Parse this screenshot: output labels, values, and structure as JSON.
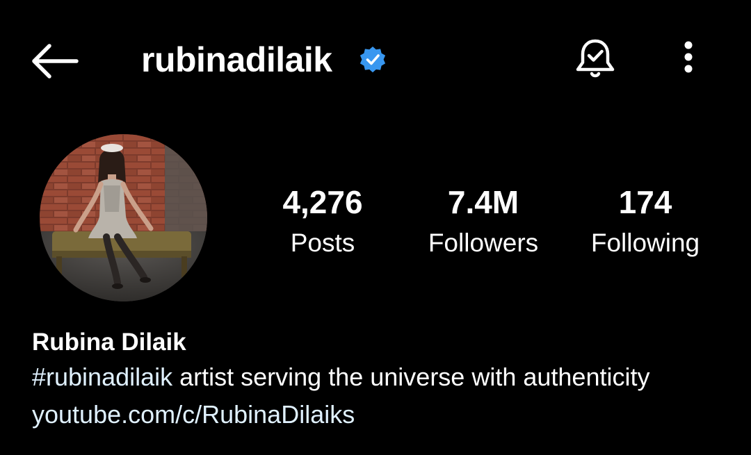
{
  "header": {
    "username": "rubinadilaik",
    "verified_color": "#3897f0",
    "back_icon": "arrow-left-icon",
    "bell_icon": "bell-check-icon",
    "more_icon": "more-vertical-icon"
  },
  "profile": {
    "avatar": "profile-photo",
    "stats": {
      "posts": {
        "value": "4,276",
        "label": "Posts"
      },
      "followers": {
        "value": "7.4M",
        "label": "Followers"
      },
      "following": {
        "value": "174",
        "label": "Following"
      }
    }
  },
  "bio": {
    "full_name": "Rubina Dilaik",
    "hashtag": "#rubinadilaik",
    "text": " artist serving the universe with authenticity",
    "link": "youtube.com/c/RubinaDilaiks",
    "link_color": "#e0f1ff"
  }
}
